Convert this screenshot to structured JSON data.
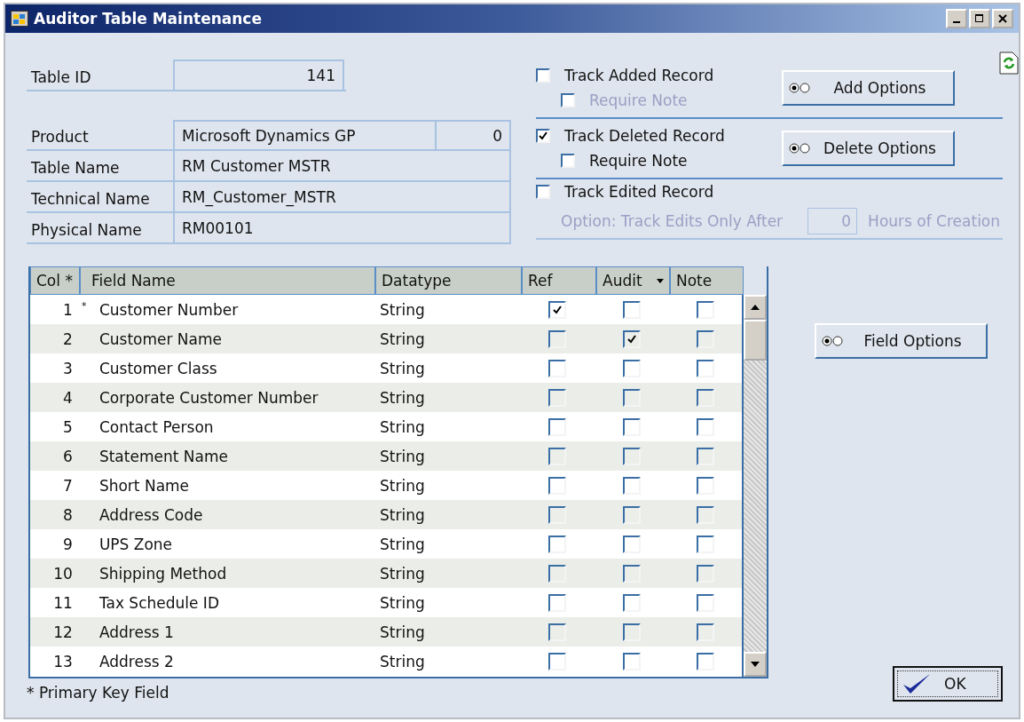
{
  "window": {
    "title": "Auditor Table Maintenance"
  },
  "table_id": {
    "label": "Table ID",
    "value": "141"
  },
  "info": [
    {
      "label": "Product",
      "value": "Microsoft Dynamics GP",
      "extra": "0"
    },
    {
      "label": "Table Name",
      "value": "RM Customer MSTR"
    },
    {
      "label": "Technical Name",
      "value": "RM_Customer_MSTR"
    },
    {
      "label": "Physical Name",
      "value": "RM00101"
    }
  ],
  "tracking": [
    {
      "label": "Track Added Record",
      "checked": false,
      "note": {
        "label": "Require Note",
        "checked": false,
        "disabled": true
      },
      "button": "Add Options"
    },
    {
      "label": "Track Deleted Record",
      "checked": true,
      "note": {
        "label": "Require Note",
        "checked": false,
        "disabled": false
      },
      "button": "Delete Options"
    }
  ],
  "track_edited": {
    "label": "Track Edited Record",
    "checked": false,
    "option_label": "Option: Track Edits Only After",
    "hours": "0",
    "hours_label": "Hours of Creation",
    "disabled": true
  },
  "table": {
    "columns": [
      "Col *",
      "Field Name",
      "Datatype",
      "Ref",
      "Audit",
      "Note"
    ],
    "rows": [
      {
        "col": "1",
        "marker": "*",
        "field": "Customer Number",
        "datatype": "String",
        "ref": true,
        "audit": false,
        "note": false
      },
      {
        "col": "2",
        "field": "Customer Name",
        "datatype": "String",
        "ref": false,
        "audit": true,
        "note": false
      },
      {
        "col": "3",
        "field": "Customer Class",
        "datatype": "String",
        "ref": false,
        "audit": false,
        "note": false
      },
      {
        "col": "4",
        "field": "Corporate Customer Number",
        "datatype": "String",
        "ref": false,
        "audit": false,
        "note": false
      },
      {
        "col": "5",
        "field": "Contact Person",
        "datatype": "String",
        "ref": false,
        "audit": false,
        "note": false
      },
      {
        "col": "6",
        "field": "Statement Name",
        "datatype": "String",
        "ref": false,
        "audit": false,
        "note": false
      },
      {
        "col": "7",
        "field": "Short Name",
        "datatype": "String",
        "ref": false,
        "audit": false,
        "note": false
      },
      {
        "col": "8",
        "field": "Address Code",
        "datatype": "String",
        "ref": false,
        "audit": false,
        "note": false
      },
      {
        "col": "9",
        "field": "UPS Zone",
        "datatype": "String",
        "ref": false,
        "audit": false,
        "note": false
      },
      {
        "col": "10",
        "field": "Shipping Method",
        "datatype": "String",
        "ref": false,
        "audit": false,
        "note": false
      },
      {
        "col": "11",
        "field": "Tax Schedule ID",
        "datatype": "String",
        "ref": false,
        "audit": false,
        "note": false
      },
      {
        "col": "12",
        "field": "Address 1",
        "datatype": "String",
        "ref": false,
        "audit": false,
        "note": false
      },
      {
        "col": "13",
        "field": "Address 2",
        "datatype": "String",
        "ref": false,
        "audit": false,
        "note": false
      }
    ]
  },
  "field_options_button": "Field Options",
  "footnote": "* Primary Key Field",
  "ok_button": "OK"
}
